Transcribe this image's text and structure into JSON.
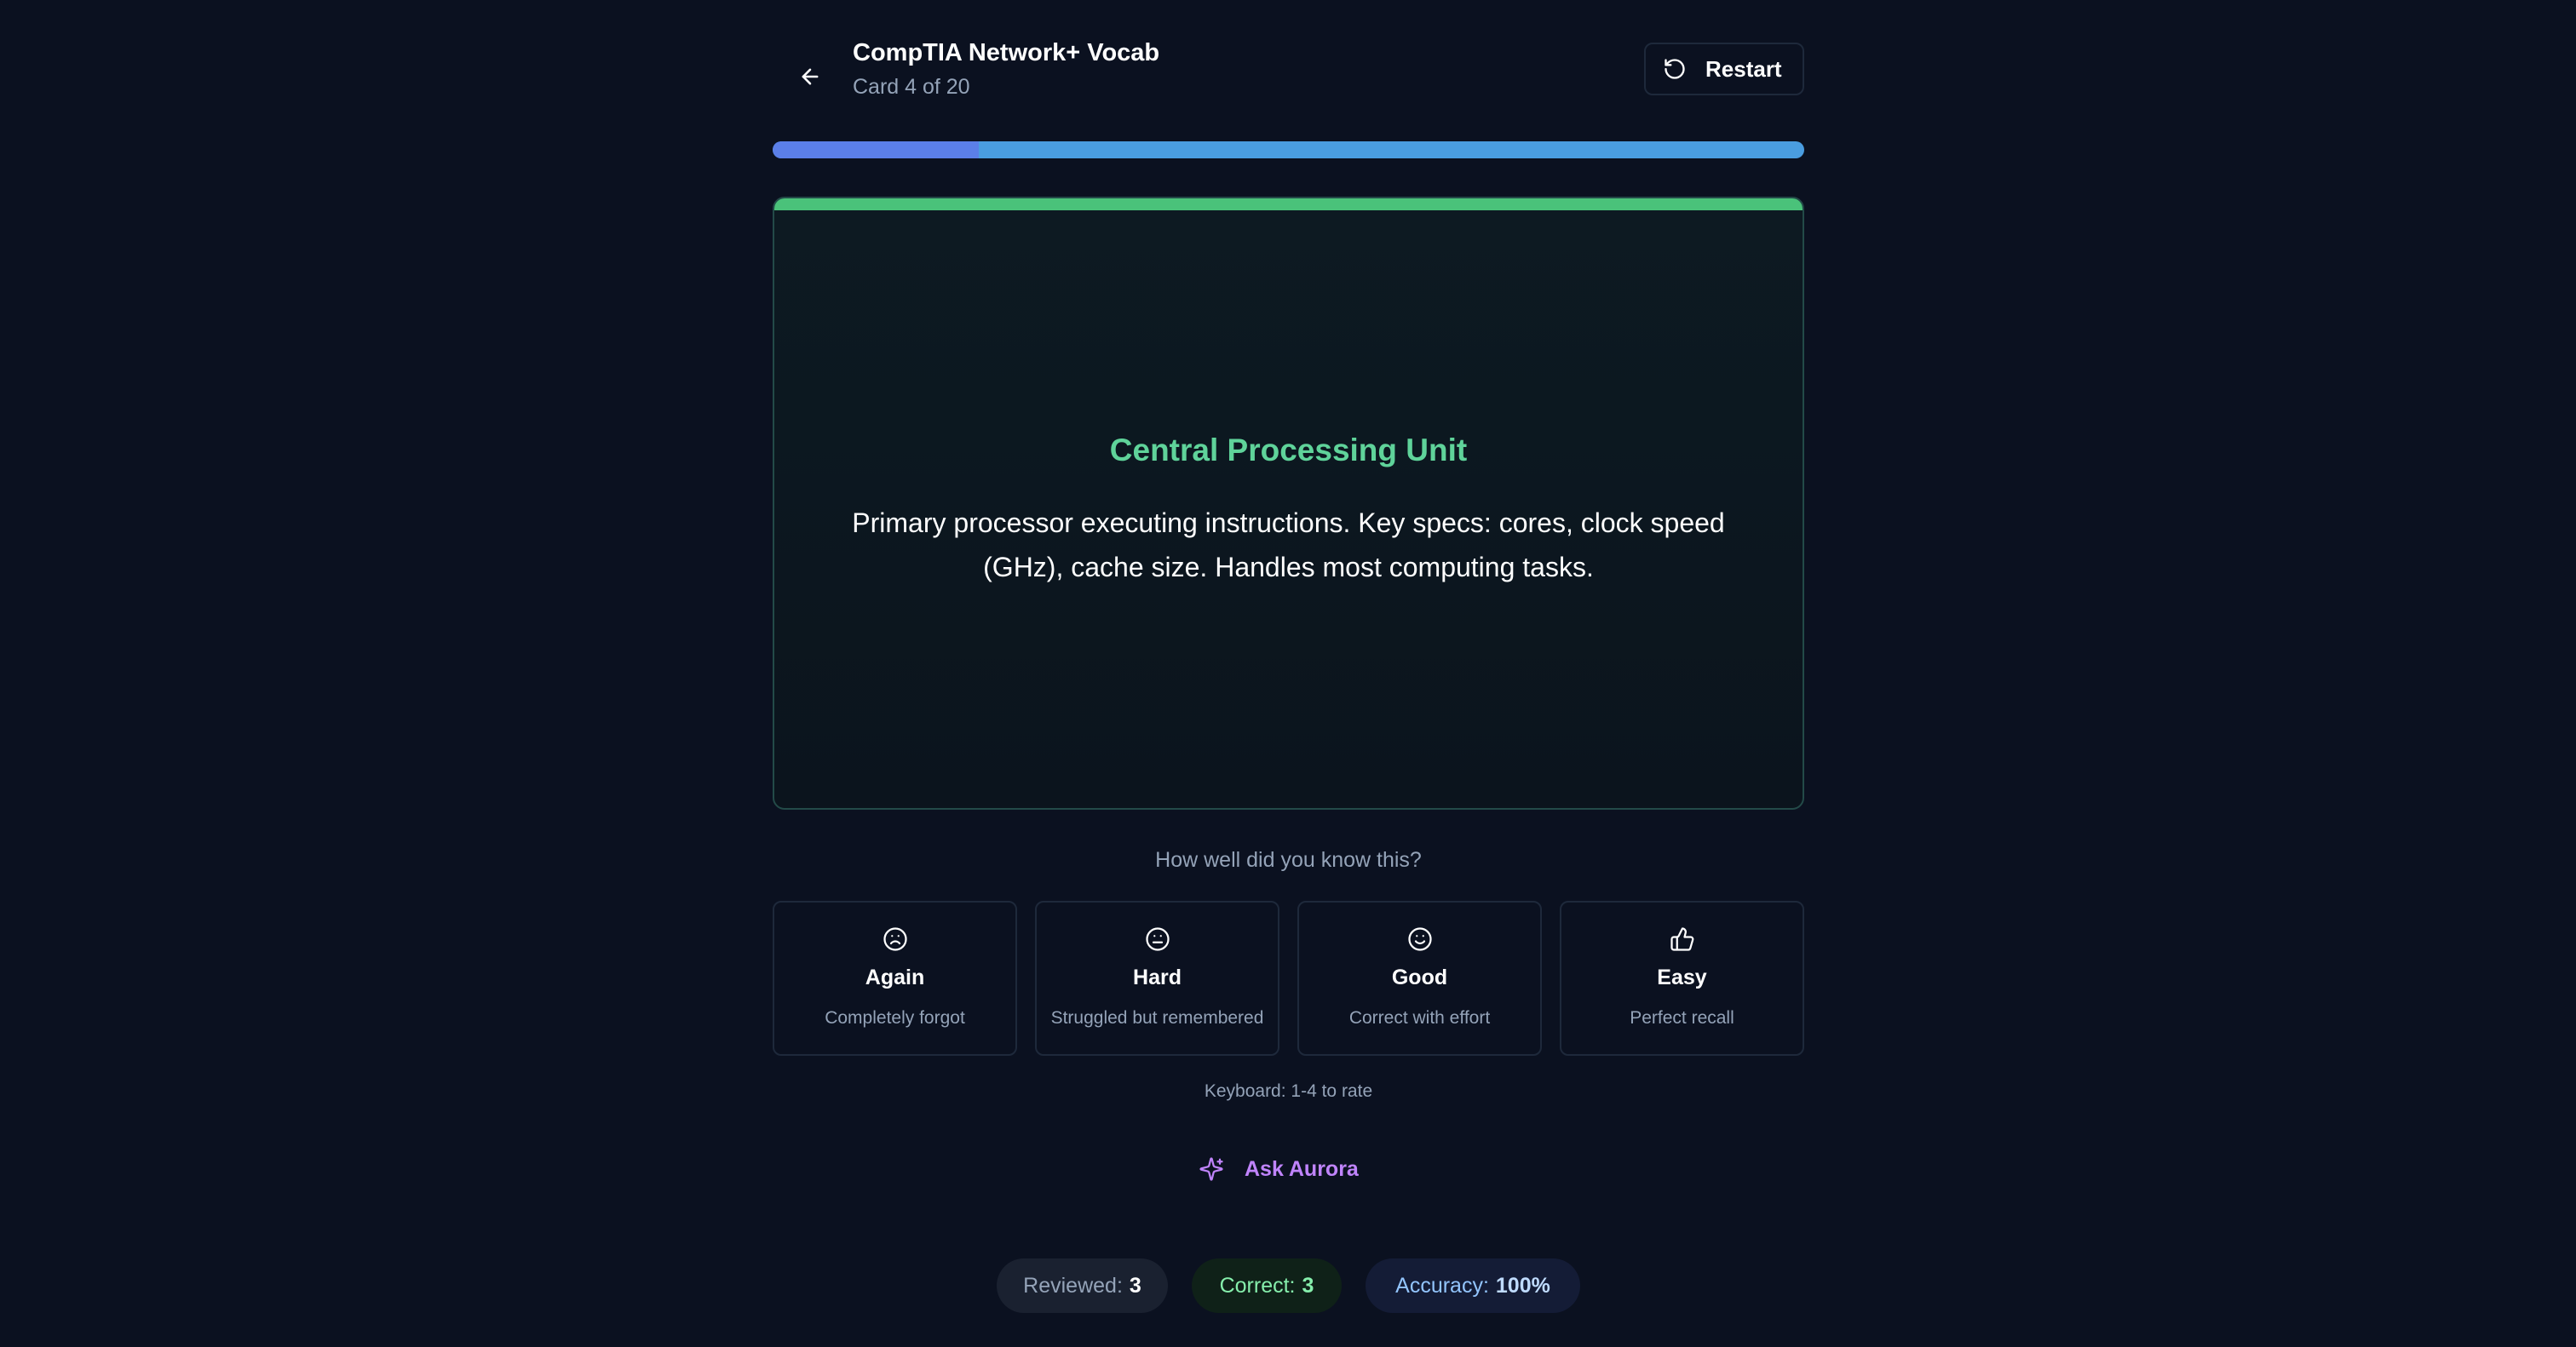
{
  "header": {
    "title": "CompTIA Network+ Vocab",
    "subtitle": "Card 4 of 20",
    "restart_label": "Restart",
    "back_icon": "arrow-left-icon",
    "restart_icon": "rotate-ccw-icon"
  },
  "progress": {
    "current_card": 4,
    "total_cards": 20,
    "fraction": 0.2
  },
  "card": {
    "term": "Central Processing Unit",
    "definition": "Primary processor executing instructions. Key specs: cores, clock speed (GHz), cache size. Handles most computing tasks."
  },
  "rating": {
    "prompt": "How well did you know this?",
    "options": [
      {
        "label": "Again",
        "description": "Completely forgot",
        "icon": "frown-icon"
      },
      {
        "label": "Hard",
        "description": "Struggled but remembered",
        "icon": "meh-icon"
      },
      {
        "label": "Good",
        "description": "Correct with effort",
        "icon": "smile-icon"
      },
      {
        "label": "Easy",
        "description": "Perfect recall",
        "icon": "thumbs-up-icon"
      }
    ],
    "keyboard_hint": "Keyboard: 1-4 to rate"
  },
  "assistant": {
    "label": "Ask Aurora",
    "icon": "sparkles-icon"
  },
  "stats": {
    "reviewed_label": "Reviewed:",
    "reviewed_value": "3",
    "correct_label": "Correct:",
    "correct_value": "3",
    "accuracy_label": "Accuracy:",
    "accuracy_value": "100%"
  },
  "colors": {
    "background": "#0b1120",
    "accent_green": "#4ac27a",
    "term_green": "#5fd39a",
    "progress_fill": "#5b7fe8",
    "progress_track": "#4a9de0",
    "aurora_purple": "#c084fc"
  }
}
